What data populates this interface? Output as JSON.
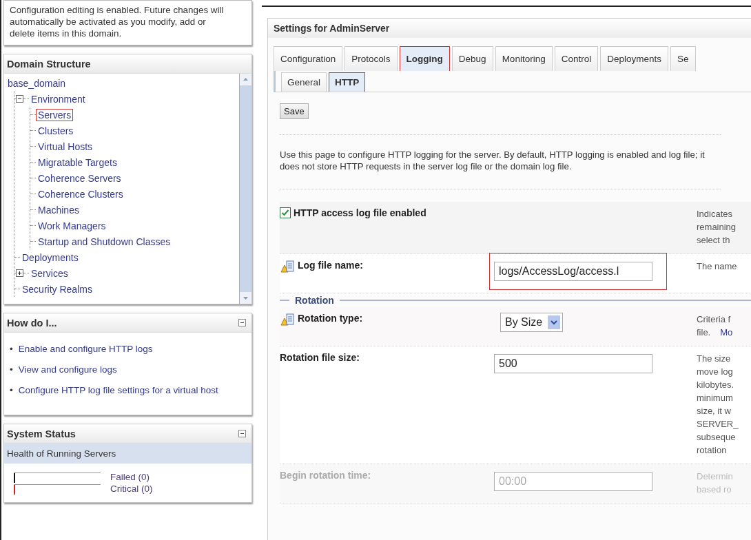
{
  "notice": "Configuration editing is enabled. Future changes will automatically be activated as you modify, add or delete items in this domain.",
  "domain_structure": {
    "title": "Domain Structure",
    "tree": [
      {
        "label": "base_domain",
        "children": [
          {
            "label": "Environment",
            "expanded": true,
            "children": [
              {
                "label": "Servers",
                "highlighted": true
              },
              {
                "label": "Clusters",
                "highlighted": false
              },
              {
                "label": "Virtual Hosts",
                "highlighted": false
              },
              {
                "label": "Migratable Targets",
                "highlighted": false
              },
              {
                "label": "Coherence Servers",
                "highlighted": false
              },
              {
                "label": "Coherence Clusters",
                "highlighted": false
              },
              {
                "label": "Machines",
                "highlighted": false
              },
              {
                "label": "Work Managers",
                "highlighted": false
              },
              {
                "label": "Startup and Shutdown Classes",
                "highlighted": false
              }
            ]
          },
          {
            "label": "Deployments"
          },
          {
            "label": "Services",
            "expanded": false
          },
          {
            "label": "Security Realms"
          }
        ]
      }
    ]
  },
  "how_do_i": {
    "title": "How do I...",
    "bullet": "•",
    "links": [
      "Enable and configure HTTP logs",
      "View and configure logs",
      "Configure HTTP log file settings for a virtual host"
    ]
  },
  "system_status": {
    "title": "System Status",
    "subtitle": "Health of Running Servers",
    "rows": [
      {
        "label": "Failed (0)",
        "color": "#111111"
      },
      {
        "label": "Critical (0)",
        "color": "#cc2222"
      }
    ]
  },
  "settings": {
    "title": "Settings for AdminServer",
    "tabs": [
      {
        "label": "Configuration",
        "selected": false,
        "highlighted": false
      },
      {
        "label": "Protocols",
        "selected": false,
        "highlighted": false
      },
      {
        "label": "Logging",
        "selected": true,
        "highlighted": true
      },
      {
        "label": "Debug",
        "selected": false,
        "highlighted": false
      },
      {
        "label": "Monitoring",
        "selected": false,
        "highlighted": false
      },
      {
        "label": "Control",
        "selected": false,
        "highlighted": false
      },
      {
        "label": "Deployments",
        "selected": false,
        "highlighted": false
      },
      {
        "label": "Se",
        "selected": false,
        "highlighted": false
      }
    ],
    "subtabs": [
      {
        "label": "General",
        "selected": false,
        "highlighted": false
      },
      {
        "label": "HTTP",
        "selected": true,
        "highlighted": true
      }
    ],
    "save_button": "Save",
    "description": "Use this page to configure HTTP logging for the server. By default, HTTP logging is enabled and log file; it does not store HTTP requests in the server log file or the domain log file.",
    "rows": [
      {
        "kind": "checkbox",
        "label": "HTTP access log file enabled",
        "checked": true,
        "help": [
          "Indicates",
          "remaining",
          "select th"
        ]
      },
      {
        "kind": "text",
        "label": "Log file name:",
        "restart_icon": true,
        "value": "logs/AccessLog/access.l",
        "highlighted": true,
        "help": [
          "The name"
        ]
      },
      {
        "kind": "section",
        "label": "Rotation"
      },
      {
        "kind": "select",
        "label": "Rotation type:",
        "restart_icon": true,
        "value": "By Size",
        "help": [
          "Criteria f",
          "file."
        ],
        "help_link": "Mo"
      },
      {
        "kind": "text",
        "label": "Rotation file size:",
        "restart_icon": false,
        "value": "500",
        "highlighted": false,
        "help": [
          "The size",
          "move log",
          "kilobytes.",
          "minimum",
          "size, it w",
          "SERVER_",
          "subseque",
          "rotation"
        ]
      },
      {
        "kind": "text",
        "label": "Begin rotation time:",
        "restart_icon": false,
        "value": "00:00",
        "disabled": true,
        "highlighted": false,
        "help": [
          "Determin",
          "based ro"
        ]
      }
    ]
  }
}
